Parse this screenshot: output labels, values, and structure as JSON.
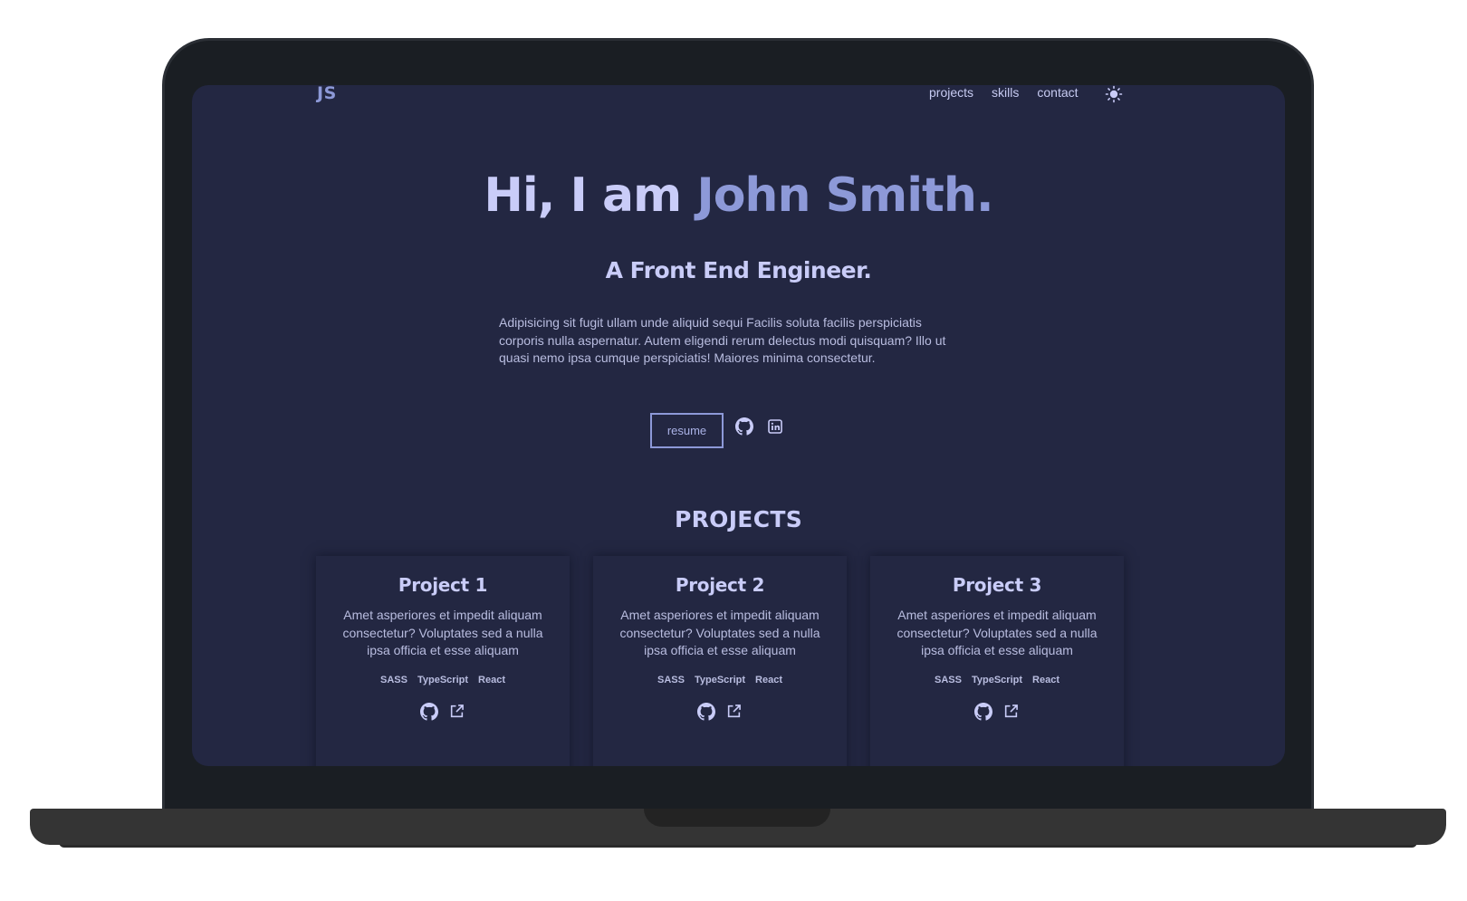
{
  "nav": {
    "logo": "JS",
    "links": [
      "projects",
      "skills",
      "contact"
    ],
    "theme_icon": "sun-icon"
  },
  "hero": {
    "greeting": "Hi, I am",
    "name": "John Smith.",
    "role": "A Front End Engineer.",
    "about": "Adipisicing sit fugit ullam unde aliquid sequi Facilis soluta facilis perspiciatis corporis nulla aspernatur. Autem eligendi rerum delectus modi quisquam? Illo ut quasi nemo ipsa cumque perspiciatis! Maiores minima consectetur.",
    "resume_label": "resume",
    "icons": [
      "github-icon",
      "linkedin-icon"
    ]
  },
  "projects": {
    "heading": "PROJECTS",
    "items": [
      {
        "title": "Project 1",
        "description": "Amet asperiores et impedit aliquam consectetur? Voluptates sed a nulla ipsa officia et esse aliquam",
        "stack": [
          "SASS",
          "TypeScript",
          "React"
        ]
      },
      {
        "title": "Project 2",
        "description": "Amet asperiores et impedit aliquam consectetur? Voluptates sed a nulla ipsa officia et esse aliquam",
        "stack": [
          "SASS",
          "TypeScript",
          "React"
        ]
      },
      {
        "title": "Project 3",
        "description": "Amet asperiores et impedit aliquam consectetur? Voluptates sed a nulla ipsa officia et esse aliquam",
        "stack": [
          "SASS",
          "TypeScript",
          "React"
        ]
      }
    ],
    "link_icons": [
      "github-icon",
      "external-link-icon"
    ]
  },
  "colors": {
    "background": "#232742",
    "text": "#c9ccf8",
    "accent": "#8d99d8",
    "frame": "#1a1e23"
  }
}
